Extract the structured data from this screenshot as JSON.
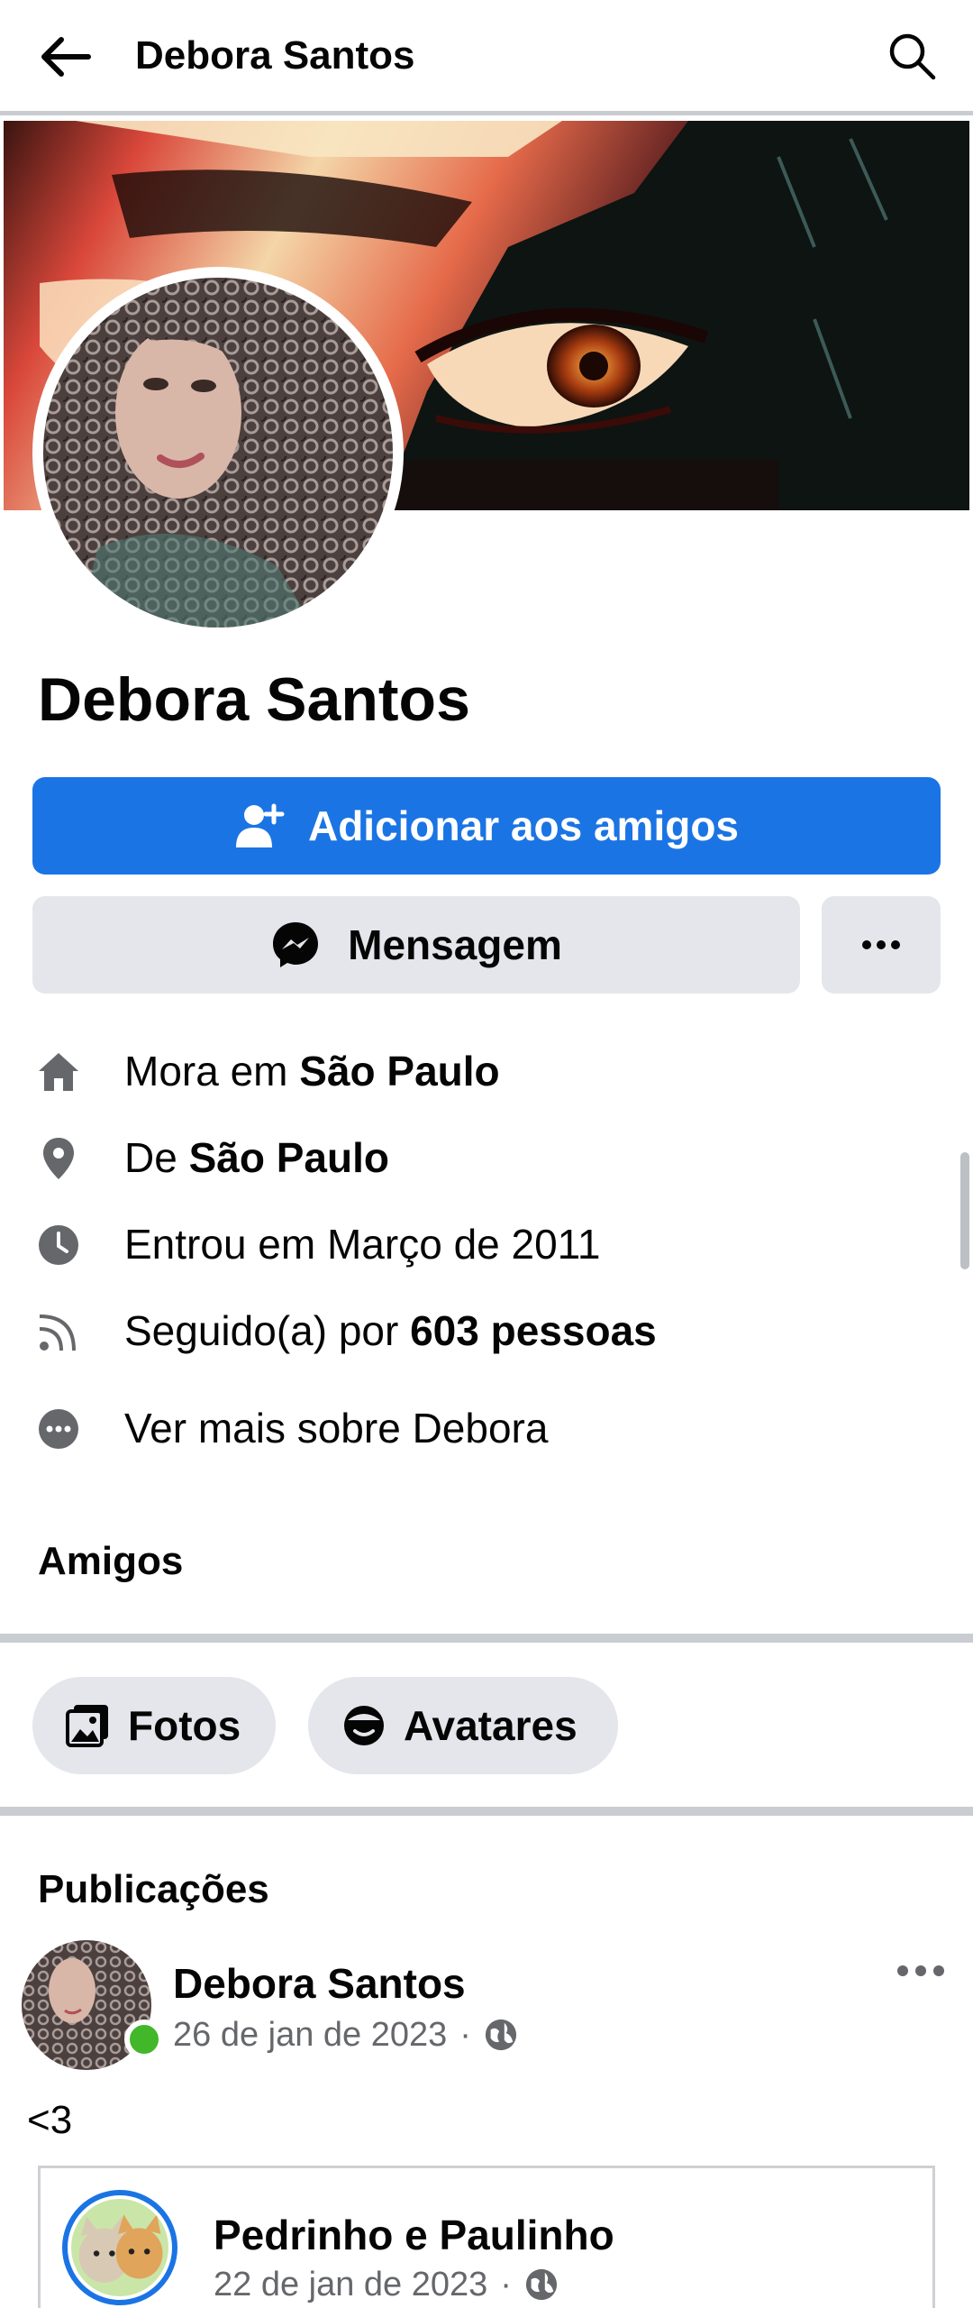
{
  "header": {
    "title": "Debora Santos"
  },
  "icons": {
    "back": "arrow-left-icon",
    "search": "search-icon",
    "add_friend": "person-add-icon",
    "messenger": "messenger-icon",
    "more": "more-horizontal-icon",
    "home": "home-icon",
    "location": "location-pin-icon",
    "clock": "clock-icon",
    "feed": "rss-icon",
    "more_info": "more-circle-icon",
    "photos": "photos-icon",
    "avatars": "avatar-face-icon",
    "globe": "globe-icon"
  },
  "colors": {
    "accent": "#1b74e4",
    "online": "#42b72a",
    "secondary_bg": "#e4e6eb",
    "meta_text": "#65676b",
    "divider": "#c9ccd1"
  },
  "profile": {
    "name": "Debora Santos",
    "add_friend_label": "Adicionar aos amigos",
    "message_label": "Mensagem"
  },
  "info": {
    "lives_prefix": "Mora em ",
    "lives_city": "São Paulo",
    "from_prefix": "De ",
    "from_city": "São Paulo",
    "joined": "Entrou em Março de 2011",
    "followed_prefix": "Seguido(a) por ",
    "followed_count": "603 pessoas",
    "see_more": "Ver mais sobre Debora"
  },
  "friends": {
    "title": "Amigos"
  },
  "chips": [
    {
      "label": "Fotos"
    },
    {
      "label": "Avatares"
    }
  ],
  "posts_section": {
    "title": "Publicações"
  },
  "post": {
    "author": "Debora Santos",
    "date": "26 de jan de 2023",
    "separator": "·",
    "text": "<3",
    "shared": {
      "name": "Pedrinho e Paulinho",
      "date": "22 de jan de 2023",
      "separator": "·"
    }
  }
}
